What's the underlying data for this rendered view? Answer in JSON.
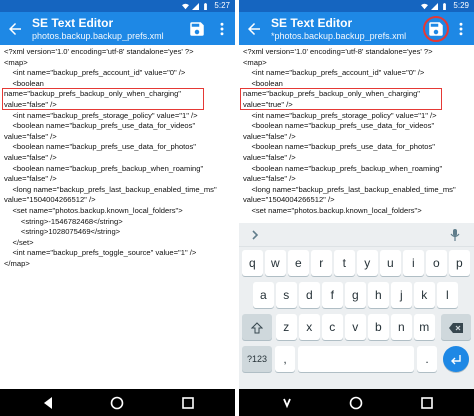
{
  "status_bar": {
    "time": "5:27"
  },
  "status_bar_right": {
    "time": "5:29"
  },
  "app": {
    "title": "SE Text Editor",
    "subtitle_left": "photos.backup.backup_prefs.xml",
    "subtitle_right": "*photos.backup.backup_prefs.xml"
  },
  "icons": {
    "back": "arrow-left-icon",
    "save": "floppy-save-icon",
    "more": "three-dot-menu-icon",
    "wifi": "wifi-icon",
    "signal": "cell-signal-icon",
    "battery": "battery-icon",
    "mic": "mic-icon",
    "chevron": "chevron-right-icon"
  },
  "colors": {
    "appbar": "#1e88e5",
    "statusbar": "#1565c0",
    "highlight": "#e53935",
    "enter_key": "#1e88e5"
  },
  "left_editor": {
    "lines": [
      "<?xml version='1.0' encoding='utf-8' standalone='yes' ?>",
      "<map>",
      "    <int name=\"backup_prefs_account_id\" value=\"0\" />",
      "    <boolean",
      "name=\"backup_prefs_backup_only_when_charging\"",
      "value=\"false\" />",
      "    <int name=\"backup_prefs_storage_policy\" value=\"1\" />",
      "    <boolean name=\"backup_prefs_use_data_for_videos\"",
      "value=\"false\" />",
      "    <boolean name=\"backup_prefs_use_data_for_photos\"",
      "value=\"false\" />",
      "    <boolean name=\"backup_prefs_backup_when_roaming\"",
      "value=\"false\" />",
      "    <long name=\"backup_prefs_last_backup_enabled_time_ms\"",
      "value=\"1504004266512\" />",
      "    <set name=\"photos.backup.known_local_folders\">",
      "        <string>-1546782468</string>",
      "        <string>1028075469</string>",
      "    </set>",
      "    <int name=\"backup_prefs_toggle_source\" value=\"1\" />",
      "</map>"
    ]
  },
  "right_editor": {
    "lines": [
      "<?xml version='1.0' encoding='utf-8' standalone='yes' ?>",
      "<map>",
      "    <int name=\"backup_prefs_account_id\" value=\"0\" />",
      "    <boolean",
      "name=\"backup_prefs_backup_only_when_charging\"",
      "value=\"true\" />",
      "    <int name=\"backup_prefs_storage_policy\" value=\"1\" />",
      "    <boolean name=\"backup_prefs_use_data_for_videos\"",
      "value=\"false\" />",
      "    <boolean name=\"backup_prefs_use_data_for_photos\"",
      "value=\"false\" />",
      "    <boolean name=\"backup_prefs_backup_when_roaming\"",
      "value=\"false\" />",
      "    <long name=\"backup_prefs_last_backup_enabled_time_ms\"",
      "value=\"1504004266512\" />",
      "    <set name=\"photos.backup.known_local_folders\">"
    ]
  },
  "keyboard": {
    "row1": [
      "q",
      "w",
      "e",
      "r",
      "t",
      "y",
      "u",
      "i",
      "o",
      "p"
    ],
    "row2": [
      "a",
      "s",
      "d",
      "f",
      "g",
      "h",
      "j",
      "k",
      "l"
    ],
    "row3": [
      "z",
      "x",
      "c",
      "v",
      "b",
      "n",
      "m"
    ],
    "bottom": {
      "symbols": "?123",
      "comma": ",",
      "period": "."
    }
  }
}
